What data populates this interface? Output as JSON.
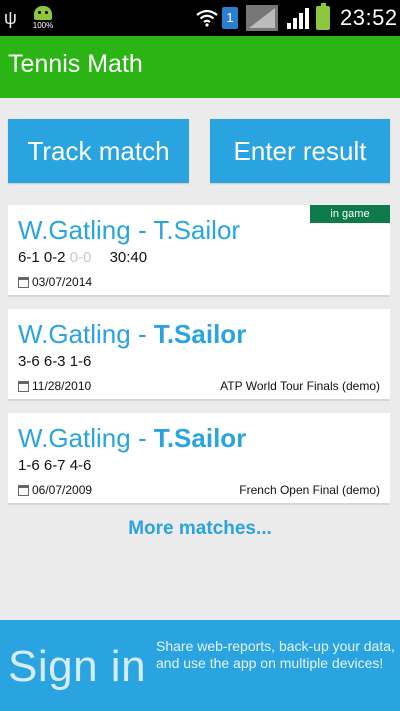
{
  "status_bar": {
    "battery_left_pct": "100%",
    "sim_badge": "1",
    "time": "23:52",
    "icons": [
      "usb-icon",
      "android-icon",
      "wifi-icon",
      "signal-icon",
      "signal-icon",
      "battery-icon"
    ]
  },
  "app": {
    "title": "Tennis Math"
  },
  "actions": {
    "track_label": "Track match",
    "enter_label": "Enter result"
  },
  "matches": [
    {
      "player1": "W.Gatling",
      "separator": " - ",
      "player2": "T.Sailor",
      "player2_bold": false,
      "sets": "6-1 0-2",
      "current_game": "0-0",
      "points": "30:40",
      "date": "03/07/2014",
      "event": "",
      "badge": "in game"
    },
    {
      "player1": "W.Gatling",
      "separator": " - ",
      "player2": "T.Sailor",
      "player2_bold": true,
      "sets": "3-6 6-3 1-6",
      "date": "11/28/2010",
      "event": "ATP World Tour Finals (demo)"
    },
    {
      "player1": "W.Gatling",
      "separator": " - ",
      "player2": "T.Sailor",
      "player2_bold": true,
      "sets": "1-6 6-7 4-6",
      "date": "06/07/2009",
      "event": "French Open Final (demo)"
    }
  ],
  "more_label": "More matches...",
  "signin": {
    "title": "Sign in",
    "description": "Share web-reports, back-up your data, and use the app on multiple devices!"
  },
  "colors": {
    "app_bar": "#2bb515",
    "accent": "#2aa4e0",
    "badge": "#0d7a4a"
  }
}
